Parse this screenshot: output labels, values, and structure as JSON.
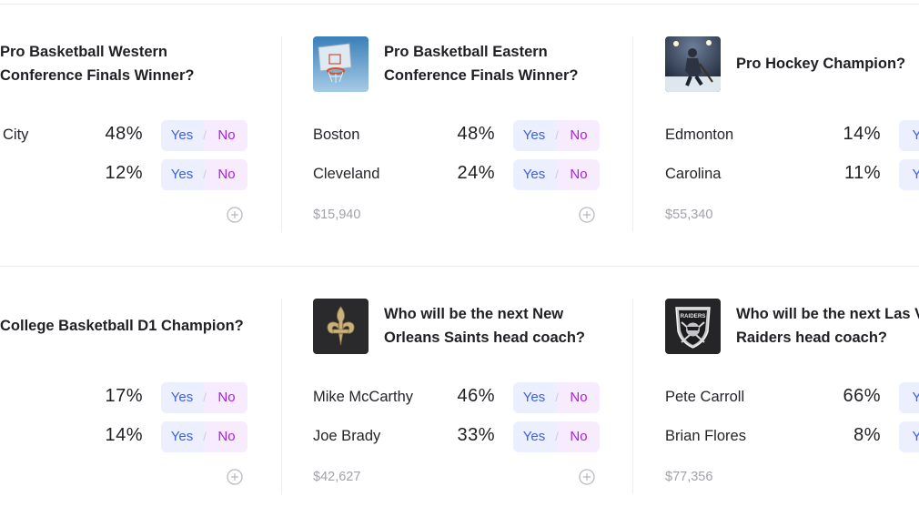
{
  "cards": [
    {
      "title_line1": "Pro Basketball Western",
      "title_line2": "Conference Finals Winner?",
      "rows": [
        {
          "name": "City",
          "pct": "48%",
          "yes": "Yes",
          "no": "No"
        },
        {
          "name": "",
          "pct": "12%",
          "yes": "Yes",
          "no": "No"
        }
      ],
      "volume": ""
    },
    {
      "title_line1": "Pro Basketball Eastern",
      "title_line2": "Conference Finals Winner?",
      "thumb": "basketball-hoop",
      "rows": [
        {
          "name": "Boston",
          "pct": "48%",
          "yes": "Yes",
          "no": "No"
        },
        {
          "name": "Cleveland",
          "pct": "24%",
          "yes": "Yes",
          "no": "No"
        }
      ],
      "volume": "$15,940"
    },
    {
      "title_line1": "Pro Hockey Champion?",
      "title_line2": "",
      "thumb": "hockey-player",
      "rows": [
        {
          "name": "Edmonton",
          "pct": "14%",
          "yes": "Ye",
          "no": ""
        },
        {
          "name": "Carolina",
          "pct": "11%",
          "yes": "Ye",
          "no": ""
        }
      ],
      "volume": "$55,340"
    },
    {
      "title_line1": "College Basketball D1 Champion?",
      "title_line2": "",
      "rows": [
        {
          "name": "",
          "pct": "17%",
          "yes": "Yes",
          "no": "No"
        },
        {
          "name": "",
          "pct": "14%",
          "yes": "Yes",
          "no": "No"
        }
      ],
      "volume": ""
    },
    {
      "title_line1": "Who will be the next New",
      "title_line2": "Orleans Saints head coach?",
      "thumb": "saints-logo",
      "rows": [
        {
          "name": "Mike McCarthy",
          "pct": "46%",
          "yes": "Yes",
          "no": "No"
        },
        {
          "name": "Joe Brady",
          "pct": "33%",
          "yes": "Yes",
          "no": "No"
        }
      ],
      "volume": "$42,627"
    },
    {
      "title_line1": "Who will be the next Las V",
      "title_line2": "Raiders head coach?",
      "thumb": "raiders-logo",
      "thumb_text": "RAIDERS",
      "rows": [
        {
          "name": "Pete Carroll",
          "pct": "66%",
          "yes": "Ye",
          "no": ""
        },
        {
          "name": "Brian Flores",
          "pct": "8%",
          "yes": "Ye",
          "no": ""
        }
      ],
      "volume": "$77,356"
    }
  ],
  "colors": {
    "yes": "#3d5fe2",
    "no": "#b01edb",
    "yes_bg": "#eceffe",
    "no_bg": "#f7ecfd",
    "divider": "#ececef"
  }
}
